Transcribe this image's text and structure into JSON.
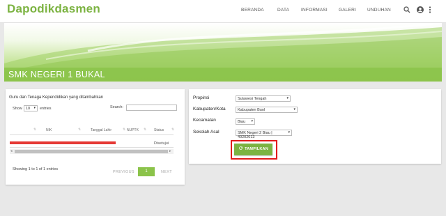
{
  "app": {
    "brand": "Dapodikdasmen"
  },
  "nav": [
    "BERANDA",
    "DATA",
    "INFORMASI",
    "GALERI",
    "UNDUHAN"
  ],
  "icons": {
    "search": "search-icon",
    "account": "account-circle-icon",
    "more": "more-vert-icon"
  },
  "hero": {
    "school_name": "SMK NEGERI 1 BUKAL"
  },
  "table_panel": {
    "title": "Guru dan Tenaga Kependidikan yang ditambahkan",
    "show_label": "Show",
    "entries_value": "10",
    "entries_label": "entries",
    "search_label": "Search:",
    "search_value": "",
    "columns": [
      "NIK",
      "Tanggal Lahir",
      "NUPTK",
      "Status"
    ],
    "rows": [
      {
        "status": "Disetujui"
      }
    ],
    "info": "Showing 1 to 1 of 1 entries",
    "pagination": {
      "previous": "PREVIOUS",
      "current": "1",
      "next": "NEXT"
    }
  },
  "filter_panel": {
    "propinsi_label": "Propinsi",
    "propinsi_value": "Sulawesi Tengah",
    "kabupaten_label": "Kabupaten/Kota",
    "kabupaten_value": "Kabupaten Buol",
    "kecamatan_label": "Kecamatan",
    "kecamatan_value": "Biau",
    "sekolah_label": "Sekolah Asal",
    "sekolah_value": "SMK Negeri 2 Biau | 40202013",
    "button_label": "TAMPILKAN"
  },
  "colors": {
    "brand": "#7cb342",
    "accent": "#8bc34a",
    "highlight": "#e21b1b",
    "redacted": "#e53935"
  }
}
